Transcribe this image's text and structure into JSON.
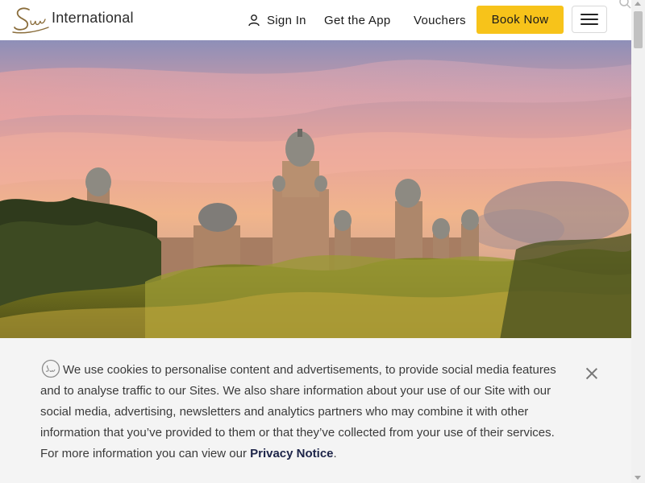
{
  "header": {
    "logo_text": "International",
    "sign_in": "Sign In",
    "get_app": "Get the App",
    "vouchers": "Vouchers",
    "book_now": "Book Now",
    "accent_color": "#f7c31a"
  },
  "hero": {
    "image": "palace-of-the-lost-city-sunset"
  },
  "cookie_banner": {
    "message": "We use cookies to personalise content and advertisements, to provide social media features and to analyse traffic to our Sites. We also share information about your use of our Site with our social media, advertising, newsletters and analytics partners who may combine it with other information that you’ve provided to them or that they’ve collected from your use of their services. For more information you can view our",
    "link_text": "Privacy Notice",
    "trailing": "."
  }
}
